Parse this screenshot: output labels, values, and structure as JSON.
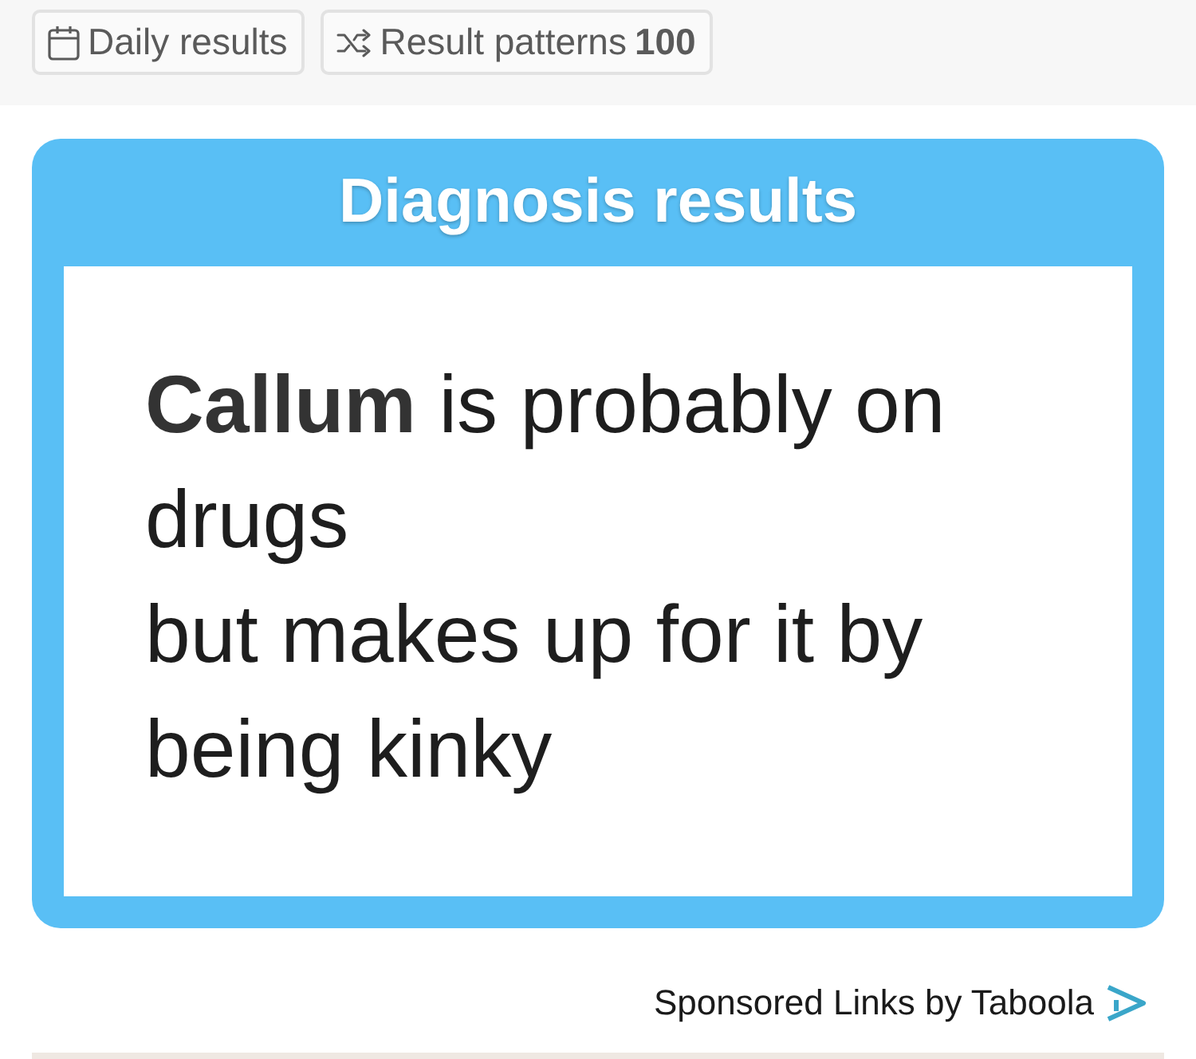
{
  "toolbar": {
    "buttons": [
      {
        "kind": "calendar",
        "label": "Daily results"
      },
      {
        "kind": "shuffle",
        "label": "Result patterns",
        "count": "100"
      }
    ]
  },
  "result_card": {
    "title": "Diagnosis results",
    "lines": [
      "**Callum** is probably on drugs",
      "but makes up for it by being kinky"
    ]
  },
  "sponsored": {
    "label": "Sponsored Links by Taboola"
  }
}
